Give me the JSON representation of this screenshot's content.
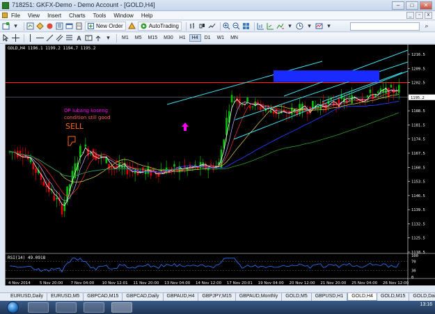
{
  "window": {
    "title": "718251: GKFX-Demo - Demo Account - [GOLD,H4]"
  },
  "menu": [
    "File",
    "View",
    "Insert",
    "Charts",
    "Tools",
    "Window",
    "Help"
  ],
  "toolbar": {
    "new_order_label": "New Order",
    "autotrading_label": "AutoTrading",
    "timeframes": [
      "M1",
      "M5",
      "M15",
      "M30",
      "H1",
      "H4",
      "D1",
      "W1",
      "MN"
    ],
    "active_timeframe": "H4"
  },
  "chart": {
    "symbol_header": "GOLD,H4  1196.1 1199.2 1194.7 1195.2",
    "annotation_line1": "OP lubang koseng",
    "annotation_line2": "condition still good",
    "annotation_sell": "SELL",
    "rsi_label": "RSI(14) 49.0918",
    "colors": {
      "background": "#000000",
      "bull_candle": "#00c000",
      "bear_candle": "#e00000",
      "channel_lines": "#3fe0f0",
      "resistance_line": "#ff2020",
      "target_box": "#1a2bff",
      "annotation_magenta": "#ff00ff",
      "annotation_orange": "#ff6a00"
    }
  },
  "chart_data": {
    "type": "candlestick",
    "title": "GOLD,H4",
    "xlabel": "",
    "ylabel": "",
    "ylim": [
      1118.5,
      1216.5
    ],
    "y_ticks": [
      "1216.5",
      "1209.5",
      "1202.5",
      "1195.2",
      "1188.5",
      "1181.5",
      "1174.5",
      "1167.5",
      "1160.5",
      "1153.5",
      "1146.5",
      "1139.5",
      "1132.5",
      "1125.5",
      "1118.5"
    ],
    "x_ticks": [
      "4 Nov 2014",
      "5 Nov 20:00",
      "7 Nov 04:00",
      "10 Nov 12:01",
      "11 Nov 20:00",
      "13 Nov 04:00",
      "14 Nov 12:00",
      "17 Nov 20:01",
      "19 Nov 04:00",
      "20 Nov 12:00",
      "21 Nov 20:00",
      "25 Nov 04:00",
      "26 Nov 12:00"
    ],
    "current_price": 1195.2,
    "resistance_level": 1202.5,
    "rsi": {
      "value": 49.0918,
      "levels": [
        70,
        30
      ],
      "ticks": [
        "100",
        "70",
        "30",
        "0"
      ]
    }
  },
  "tabs": [
    "EURUSD,Daily",
    "EURUSD,M5",
    "GBPCAD,M15",
    "GBPCAD,Daily",
    "GBPAUD,H4",
    "GBPJPY,M15",
    "GBPAUD,Monthly",
    "GOLD,M5",
    "GBPUSD,H1",
    "GOLD,H4",
    "GOLD,M15",
    "GOLD,Daily"
  ],
  "active_tab": "GOLD,H4",
  "taskbar": {
    "clock": "13:16"
  }
}
